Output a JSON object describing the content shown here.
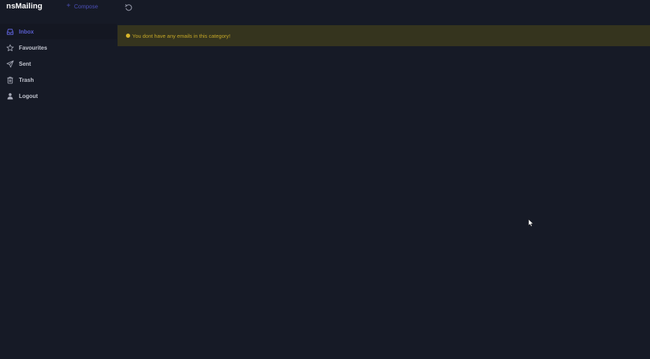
{
  "app": {
    "brand": "nsMailing"
  },
  "toolbar": {
    "compose_icon": "plus-icon",
    "compose_label": "Compose",
    "refresh_icon": "refresh-icon"
  },
  "sidebar": {
    "items": [
      {
        "label": "Inbox",
        "icon": "inbox-icon",
        "active": true
      },
      {
        "label": "Favourites",
        "icon": "star-icon",
        "active": false
      },
      {
        "label": "Sent",
        "icon": "paper-plane-icon",
        "active": false
      },
      {
        "label": "Trash",
        "icon": "trash-icon",
        "active": false
      },
      {
        "label": "Logout",
        "icon": "user-icon",
        "active": false
      }
    ]
  },
  "main": {
    "alert_text": "You dont have any emails in this category!"
  },
  "colors": {
    "background": "#161a26",
    "accent": "#5a5ed0",
    "alert_bg": "#35341e",
    "alert_text": "#c6a827"
  }
}
